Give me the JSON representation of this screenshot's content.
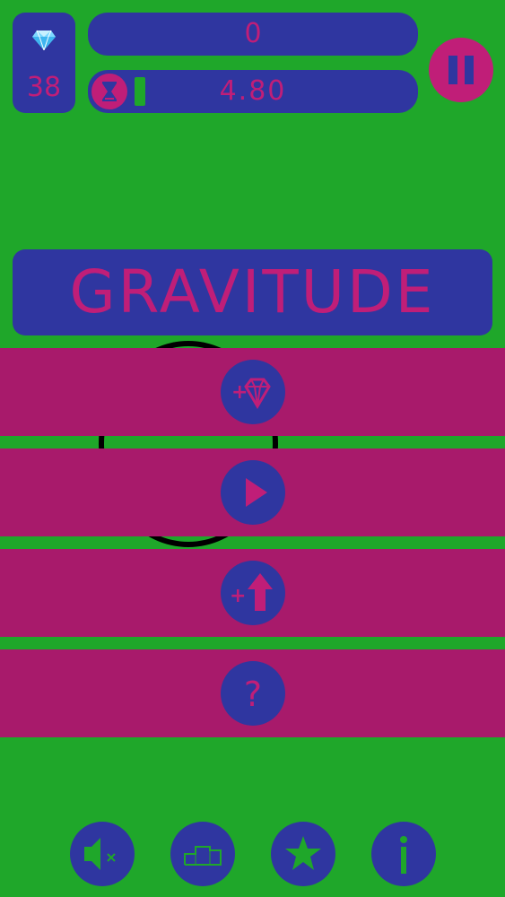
{
  "hud": {
    "gems": "38",
    "score": "0",
    "timer": "4.80",
    "timer_progress": 0.05
  },
  "title": "GRAVITUDE",
  "menu": [
    {
      "icon": "add-gems-icon"
    },
    {
      "icon": "play-icon"
    },
    {
      "icon": "upgrade-icon"
    },
    {
      "icon": "help-icon"
    }
  ],
  "bottom": [
    {
      "icon": "mute-icon"
    },
    {
      "icon": "leaderboard-icon"
    },
    {
      "icon": "star-icon"
    },
    {
      "icon": "info-icon"
    }
  ],
  "colors": {
    "background": "#1fa72a",
    "panel": "#2f36a0",
    "accent": "#c01e78",
    "stripe": "#a81a6b"
  }
}
